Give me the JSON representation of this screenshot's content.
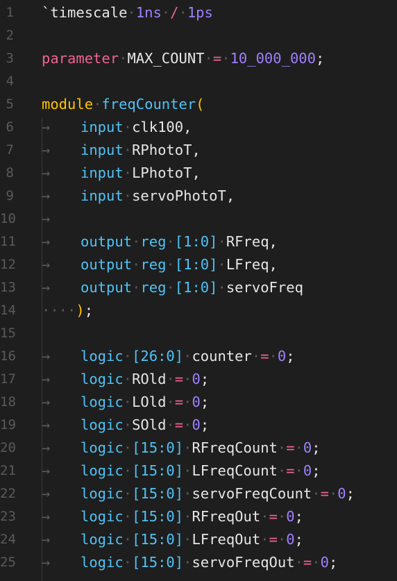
{
  "editor": {
    "language": "SystemVerilog",
    "colors": {
      "background": "#1e1e1e",
      "keyword_pink": "#f06292",
      "keyword_yellow": "#ffc400",
      "keyword_blue": "#4fc3f7",
      "number": "#9f80ff",
      "text": "#e6e6e6",
      "line_number": "#5a5a5a"
    },
    "line_numbers": [
      "1",
      "2",
      "3",
      "4",
      "5",
      "6",
      "7",
      "8",
      "9",
      "10",
      "11",
      "12",
      "13",
      "14",
      "15",
      "16",
      "17",
      "18",
      "19",
      "20",
      "21",
      "22",
      "23",
      "24",
      "25"
    ],
    "lines": [
      [
        {
          "t": "`timescale",
          "c": "plain"
        },
        {
          "t": "·",
          "c": "ws"
        },
        {
          "t": "1ns",
          "c": "num"
        },
        {
          "t": "·",
          "c": "ws"
        },
        {
          "t": "/",
          "c": "kw-pink"
        },
        {
          "t": "·",
          "c": "ws"
        },
        {
          "t": "1ps",
          "c": "num"
        }
      ],
      [],
      [
        {
          "t": "parameter",
          "c": "kw-pink"
        },
        {
          "t": "·",
          "c": "ws"
        },
        {
          "t": "MAX_COUNT",
          "c": "plain"
        },
        {
          "t": "·",
          "c": "ws"
        },
        {
          "t": "=",
          "c": "kw-pink"
        },
        {
          "t": "·",
          "c": "ws"
        },
        {
          "t": "10_000_000",
          "c": "num"
        },
        {
          "t": ";",
          "c": "plain"
        }
      ],
      [],
      [
        {
          "t": "module",
          "c": "kw-yellow"
        },
        {
          "t": "·",
          "c": "ws"
        },
        {
          "t": "freqCounter",
          "c": "kw-blue"
        },
        {
          "t": "(",
          "c": "punct-yellow"
        }
      ],
      [
        {
          "t": "→",
          "c": "tab"
        },
        {
          "t": "input",
          "c": "kw-blue"
        },
        {
          "t": "·",
          "c": "ws"
        },
        {
          "t": "clk100,",
          "c": "plain"
        }
      ],
      [
        {
          "t": "→",
          "c": "tab"
        },
        {
          "t": "input",
          "c": "kw-blue"
        },
        {
          "t": "·",
          "c": "ws"
        },
        {
          "t": "RPhotoT,",
          "c": "plain"
        }
      ],
      [
        {
          "t": "→",
          "c": "tab"
        },
        {
          "t": "input",
          "c": "kw-blue"
        },
        {
          "t": "·",
          "c": "ws"
        },
        {
          "t": "LPhotoT,",
          "c": "plain"
        }
      ],
      [
        {
          "t": "→",
          "c": "tab"
        },
        {
          "t": "input",
          "c": "kw-blue"
        },
        {
          "t": "·",
          "c": "ws"
        },
        {
          "t": "servoPhotoT,",
          "c": "plain"
        }
      ],
      [
        {
          "t": "→",
          "c": "tab"
        }
      ],
      [
        {
          "t": "→",
          "c": "tab"
        },
        {
          "t": "output",
          "c": "kw-blue"
        },
        {
          "t": "·",
          "c": "ws"
        },
        {
          "t": "reg",
          "c": "kw-blue"
        },
        {
          "t": "·",
          "c": "ws"
        },
        {
          "t": "[1:0]",
          "c": "bracket"
        },
        {
          "t": "·",
          "c": "ws"
        },
        {
          "t": "RFreq,",
          "c": "plain"
        }
      ],
      [
        {
          "t": "→",
          "c": "tab"
        },
        {
          "t": "output",
          "c": "kw-blue"
        },
        {
          "t": "·",
          "c": "ws"
        },
        {
          "t": "reg",
          "c": "kw-blue"
        },
        {
          "t": "·",
          "c": "ws"
        },
        {
          "t": "[1:0]",
          "c": "bracket"
        },
        {
          "t": "·",
          "c": "ws"
        },
        {
          "t": "LFreq,",
          "c": "plain"
        }
      ],
      [
        {
          "t": "→",
          "c": "tab"
        },
        {
          "t": "output",
          "c": "kw-blue"
        },
        {
          "t": "·",
          "c": "ws"
        },
        {
          "t": "reg",
          "c": "kw-blue"
        },
        {
          "t": "·",
          "c": "ws"
        },
        {
          "t": "[1:0]",
          "c": "bracket"
        },
        {
          "t": "·",
          "c": "ws"
        },
        {
          "t": "servoFreq",
          "c": "plain"
        }
      ],
      [
        {
          "t": "····",
          "c": "ws"
        },
        {
          "t": ")",
          "c": "punct-yellow"
        },
        {
          "t": ";",
          "c": "plain"
        }
      ],
      [],
      [
        {
          "t": "→",
          "c": "tab"
        },
        {
          "t": "logic",
          "c": "kw-blue"
        },
        {
          "t": "·",
          "c": "ws"
        },
        {
          "t": "[26:0]",
          "c": "bracket"
        },
        {
          "t": "·",
          "c": "ws"
        },
        {
          "t": "counter",
          "c": "plain"
        },
        {
          "t": "·",
          "c": "ws"
        },
        {
          "t": "=",
          "c": "kw-pink"
        },
        {
          "t": "·",
          "c": "ws"
        },
        {
          "t": "0",
          "c": "num"
        },
        {
          "t": ";",
          "c": "plain"
        }
      ],
      [
        {
          "t": "→",
          "c": "tab"
        },
        {
          "t": "logic",
          "c": "kw-blue"
        },
        {
          "t": "·",
          "c": "ws"
        },
        {
          "t": "ROld",
          "c": "plain"
        },
        {
          "t": "·",
          "c": "ws"
        },
        {
          "t": "=",
          "c": "kw-pink"
        },
        {
          "t": "·",
          "c": "ws"
        },
        {
          "t": "0",
          "c": "num"
        },
        {
          "t": ";",
          "c": "plain"
        }
      ],
      [
        {
          "t": "→",
          "c": "tab"
        },
        {
          "t": "logic",
          "c": "kw-blue"
        },
        {
          "t": "·",
          "c": "ws"
        },
        {
          "t": "LOld",
          "c": "plain"
        },
        {
          "t": "·",
          "c": "ws"
        },
        {
          "t": "=",
          "c": "kw-pink"
        },
        {
          "t": "·",
          "c": "ws"
        },
        {
          "t": "0",
          "c": "num"
        },
        {
          "t": ";",
          "c": "plain"
        }
      ],
      [
        {
          "t": "→",
          "c": "tab"
        },
        {
          "t": "logic",
          "c": "kw-blue"
        },
        {
          "t": "·",
          "c": "ws"
        },
        {
          "t": "SOld",
          "c": "plain"
        },
        {
          "t": "·",
          "c": "ws"
        },
        {
          "t": "=",
          "c": "kw-pink"
        },
        {
          "t": "·",
          "c": "ws"
        },
        {
          "t": "0",
          "c": "num"
        },
        {
          "t": ";",
          "c": "plain"
        }
      ],
      [
        {
          "t": "→",
          "c": "tab"
        },
        {
          "t": "logic",
          "c": "kw-blue"
        },
        {
          "t": "·",
          "c": "ws"
        },
        {
          "t": "[15:0]",
          "c": "bracket"
        },
        {
          "t": "·",
          "c": "ws"
        },
        {
          "t": "RFreqCount",
          "c": "plain"
        },
        {
          "t": "·",
          "c": "ws"
        },
        {
          "t": "=",
          "c": "kw-pink"
        },
        {
          "t": "·",
          "c": "ws"
        },
        {
          "t": "0",
          "c": "num"
        },
        {
          "t": ";",
          "c": "plain"
        }
      ],
      [
        {
          "t": "→",
          "c": "tab"
        },
        {
          "t": "logic",
          "c": "kw-blue"
        },
        {
          "t": "·",
          "c": "ws"
        },
        {
          "t": "[15:0]",
          "c": "bracket"
        },
        {
          "t": "·",
          "c": "ws"
        },
        {
          "t": "LFreqCount",
          "c": "plain"
        },
        {
          "t": "·",
          "c": "ws"
        },
        {
          "t": "=",
          "c": "kw-pink"
        },
        {
          "t": "·",
          "c": "ws"
        },
        {
          "t": "0",
          "c": "num"
        },
        {
          "t": ";",
          "c": "plain"
        }
      ],
      [
        {
          "t": "→",
          "c": "tab"
        },
        {
          "t": "logic",
          "c": "kw-blue"
        },
        {
          "t": "·",
          "c": "ws"
        },
        {
          "t": "[15:0]",
          "c": "bracket"
        },
        {
          "t": "·",
          "c": "ws"
        },
        {
          "t": "servoFreqCount",
          "c": "plain"
        },
        {
          "t": "·",
          "c": "ws"
        },
        {
          "t": "=",
          "c": "kw-pink"
        },
        {
          "t": "·",
          "c": "ws"
        },
        {
          "t": "0",
          "c": "num"
        },
        {
          "t": ";",
          "c": "plain"
        }
      ],
      [
        {
          "t": "→",
          "c": "tab"
        },
        {
          "t": "logic",
          "c": "kw-blue"
        },
        {
          "t": "·",
          "c": "ws"
        },
        {
          "t": "[15:0]",
          "c": "bracket"
        },
        {
          "t": "·",
          "c": "ws"
        },
        {
          "t": "RFreqOut",
          "c": "plain"
        },
        {
          "t": "·",
          "c": "ws"
        },
        {
          "t": "=",
          "c": "kw-pink"
        },
        {
          "t": "·",
          "c": "ws"
        },
        {
          "t": "0",
          "c": "num"
        },
        {
          "t": ";",
          "c": "plain"
        }
      ],
      [
        {
          "t": "→",
          "c": "tab"
        },
        {
          "t": "logic",
          "c": "kw-blue"
        },
        {
          "t": "·",
          "c": "ws"
        },
        {
          "t": "[15:0]",
          "c": "bracket"
        },
        {
          "t": "·",
          "c": "ws"
        },
        {
          "t": "LFreqOut",
          "c": "plain"
        },
        {
          "t": "·",
          "c": "ws"
        },
        {
          "t": "=",
          "c": "kw-pink"
        },
        {
          "t": "·",
          "c": "ws"
        },
        {
          "t": "0",
          "c": "num"
        },
        {
          "t": ";",
          "c": "plain"
        }
      ],
      [
        {
          "t": "→",
          "c": "tab"
        },
        {
          "t": "logic",
          "c": "kw-blue"
        },
        {
          "t": "·",
          "c": "ws"
        },
        {
          "t": "[15:0]",
          "c": "bracket"
        },
        {
          "t": "·",
          "c": "ws"
        },
        {
          "t": "servoFreqOut",
          "c": "plain"
        },
        {
          "t": "·",
          "c": "ws"
        },
        {
          "t": "=",
          "c": "kw-pink"
        },
        {
          "t": "·",
          "c": "ws"
        },
        {
          "t": "0",
          "c": "num"
        },
        {
          "t": ";",
          "c": "plain"
        }
      ]
    ]
  }
}
